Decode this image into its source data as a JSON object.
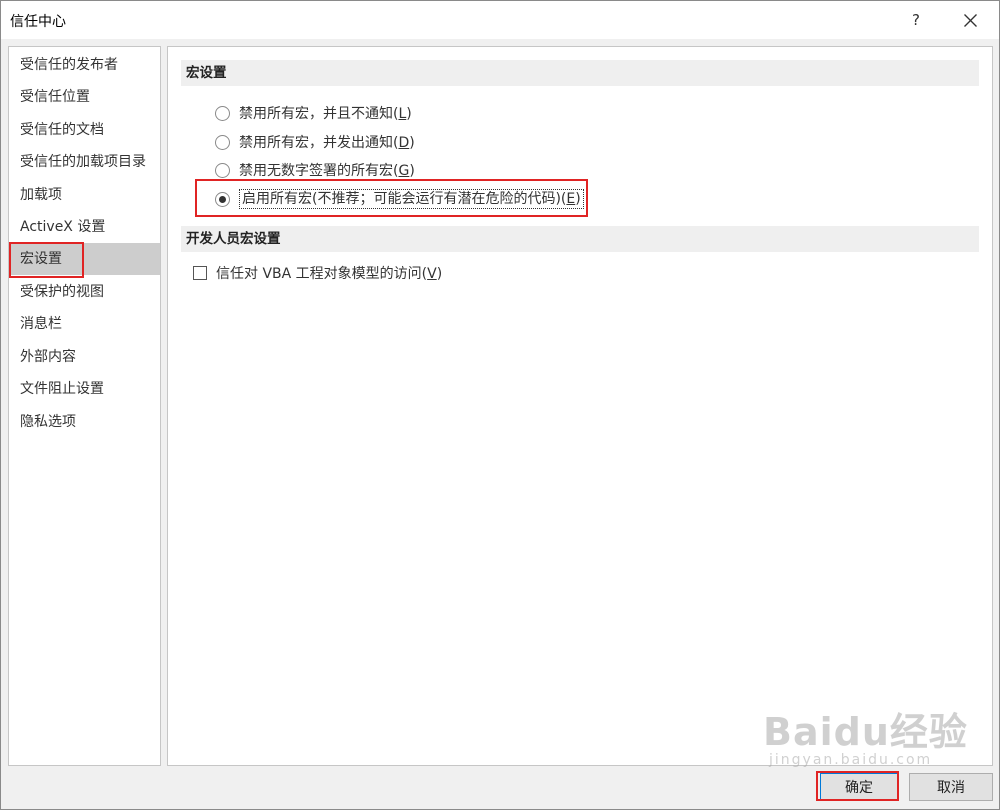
{
  "window": {
    "title": "信任中心",
    "help_label": "?"
  },
  "sidebar": {
    "items": [
      {
        "label": "受信任的发布者",
        "selected": false
      },
      {
        "label": "受信任位置",
        "selected": false
      },
      {
        "label": "受信任的文档",
        "selected": false
      },
      {
        "label": "受信任的加载项目录",
        "selected": false
      },
      {
        "label": "加载项",
        "selected": false
      },
      {
        "label": "ActiveX 设置",
        "selected": false
      },
      {
        "label": "宏设置",
        "selected": true
      },
      {
        "label": "受保护的视图",
        "selected": false
      },
      {
        "label": "消息栏",
        "selected": false
      },
      {
        "label": "外部内容",
        "selected": false
      },
      {
        "label": "文件阻止设置",
        "selected": false
      },
      {
        "label": "隐私选项",
        "selected": false
      }
    ]
  },
  "macro_settings": {
    "header": "宏设置",
    "options": [
      {
        "text": "禁用所有宏，并且不通知(",
        "key": "L",
        "suffix": ")",
        "checked": false
      },
      {
        "text": "禁用所有宏，并发出通知(",
        "key": "D",
        "suffix": ")",
        "checked": false
      },
      {
        "text": "禁用无数字签署的所有宏(",
        "key": "G",
        "suffix": ")",
        "checked": false
      },
      {
        "text": "启用所有宏(不推荐；可能会运行有潜在危险的代码)(",
        "key": "E",
        "suffix": ")",
        "checked": true
      }
    ]
  },
  "developer": {
    "header": "开发人员宏设置",
    "checkbox": {
      "text": "信任对 VBA 工程对象模型的访问(",
      "key": "V",
      "suffix": ")",
      "checked": false
    }
  },
  "buttons": {
    "ok": "确定",
    "cancel": "取消"
  },
  "watermark": {
    "main": "Baidu经验",
    "sub": "jingyan.baidu.com"
  },
  "colors": {
    "highlight": "#e02424",
    "selected_bg": "#cdcdcd"
  }
}
